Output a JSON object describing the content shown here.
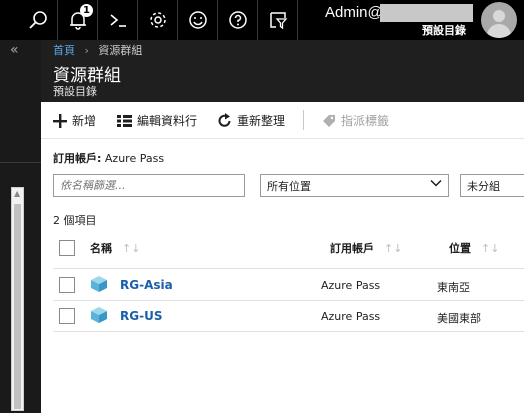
{
  "topbar": {
    "notification_count": "1",
    "user_name": "Admin@",
    "directory": "預設目錄"
  },
  "breadcrumb": {
    "home": "首頁",
    "current": "資源群組"
  },
  "blade": {
    "title": "資源群組",
    "subtitle": "預設目錄"
  },
  "commands": {
    "add": "新增",
    "edit_columns": "編輯資料行",
    "refresh": "重新整理",
    "assign_tags": "指派標籤"
  },
  "subscription": {
    "label": "訂用帳戶:",
    "value": "Azure Pass"
  },
  "filters": {
    "name_placeholder": "依名稱篩選...",
    "location": "所有位置",
    "grouping": "未分組"
  },
  "item_count": "2 個項目",
  "table": {
    "headers": {
      "name": "名稱",
      "subscription": "訂用帳戶",
      "location": "位置"
    },
    "rows": [
      {
        "name": "RG-Asia",
        "subscription": "Azure Pass",
        "location": "東南亞"
      },
      {
        "name": "RG-US",
        "subscription": "Azure Pass",
        "location": "美國東部"
      }
    ]
  },
  "colors": {
    "accent": "#1a5fa8",
    "topbar": "#000000",
    "blade_header": "#1f1f1f",
    "icon_blue": "#59b4d9"
  },
  "icons": [
    "search-icon",
    "bell-icon",
    "cloud-shell-icon",
    "gear-icon",
    "smiley-icon",
    "help-icon",
    "directory-filter-icon",
    "plus-icon",
    "columns-icon",
    "refresh-icon",
    "tag-icon",
    "cube-icon"
  ]
}
